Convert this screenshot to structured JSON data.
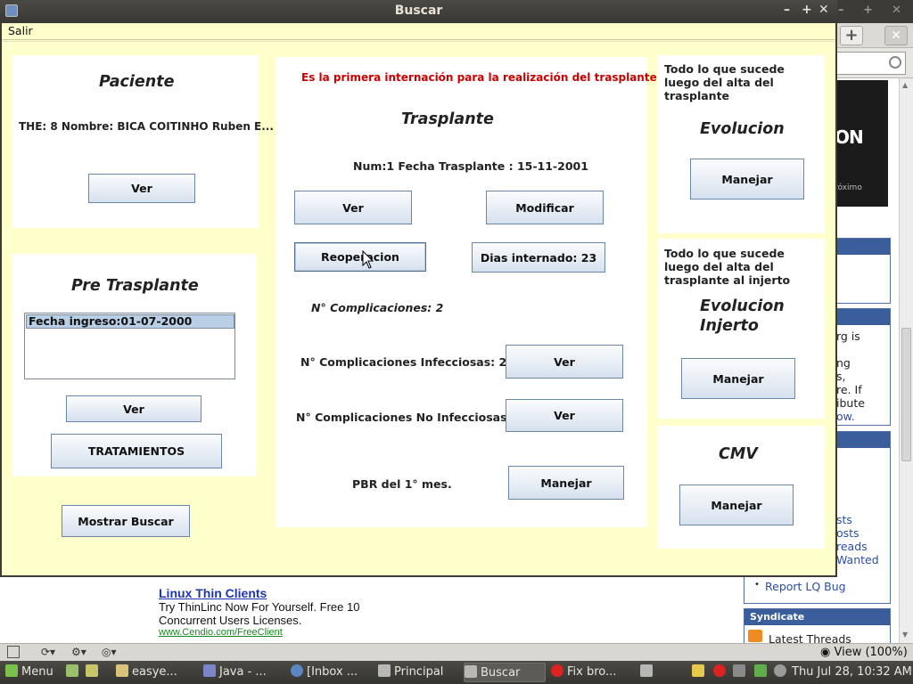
{
  "window": {
    "title": "Buscar",
    "menu_salir": "Salir",
    "btn_min": "–",
    "btn_max": "+",
    "btn_close": "✕"
  },
  "paciente": {
    "title": "Paciente",
    "info": "THE: 8 Nombre: BICA COITINHO Ruben E...",
    "ver_label": "Ver"
  },
  "pre_trasplante": {
    "title": "Pre Trasplante",
    "list_items": [
      "Fecha ingreso:01-07-2000"
    ],
    "ver_label": "Ver",
    "tratamientos_label": "TRATAMIENTOS"
  },
  "mostrar_buscar_label": "Mostrar Buscar",
  "trasplante": {
    "notice": "Es la primera internación para la realización del trasplante",
    "title": "Trasplante",
    "num_fecha": "Num:1 Fecha Trasplante : 15-11-2001",
    "ver_label": "Ver",
    "modificar_label": "Modificar",
    "reoperacion_label": "Reoperacion",
    "dias_internado_label": "Dias internado: 23",
    "complicaciones": "N° Complicaciones: 2",
    "infecciosas": "N° Complicaciones Infecciosas: 2",
    "infecciosas_ver": "Ver",
    "no_infecciosas": "N° Complicaciones No Infecciosas...",
    "no_infecciosas_ver": "Ver",
    "pbr": "PBR del 1° mes.",
    "pbr_manejar": "Manejar"
  },
  "evolucion": {
    "desc_line1": "Todo lo que sucede",
    "desc_line2": "luego del alta del",
    "desc_line3": "trasplante",
    "title": "Evolucion",
    "manejar_label": "Manejar"
  },
  "evolucion_injerto": {
    "desc_line1": "Todo lo que sucede",
    "desc_line2": "luego del alta del",
    "desc_line3": "trasplante al injerto",
    "title_line1": "Evolucion",
    "title_line2": "Injerto",
    "manejar_label": "Manejar"
  },
  "cmv": {
    "title": "CMV",
    "manejar_label": "Manejar"
  },
  "background_browser": {
    "ad_text": "ON",
    "ad_sub": "róximo",
    "sidebar_texts": [
      "rg is",
      "ng",
      "s,",
      "re. If",
      "ibute",
      "ow."
    ],
    "sidebar_links": [
      "sts",
      "osts",
      "reads",
      "Wanted"
    ],
    "report_bug": "Report LQ Bug",
    "syndicate_header": "Syndicate",
    "latest_threads": "Latest Threads",
    "ad2_title": "Linux Thin Clients",
    "ad2_line1": "Try ThinLinc Now For Yourself. Free 10",
    "ad2_line2": "Concurrent Users Licenses.",
    "ad2_url": "www.Cendio.com/FreeClient",
    "zoom": "View (100%)"
  },
  "taskbar": {
    "menu_label": "Menu",
    "items": [
      "easye...",
      "Java - ...",
      "[Inbox ...",
      "Principal",
      "Buscar",
      "Fix bro..."
    ],
    "clock": "Thu Jul 28, 10:32 AM"
  },
  "colors": {
    "dialog_bg": "#ffffcc",
    "notice_red": "#cc0000",
    "titlebar": "#3c3b37"
  }
}
